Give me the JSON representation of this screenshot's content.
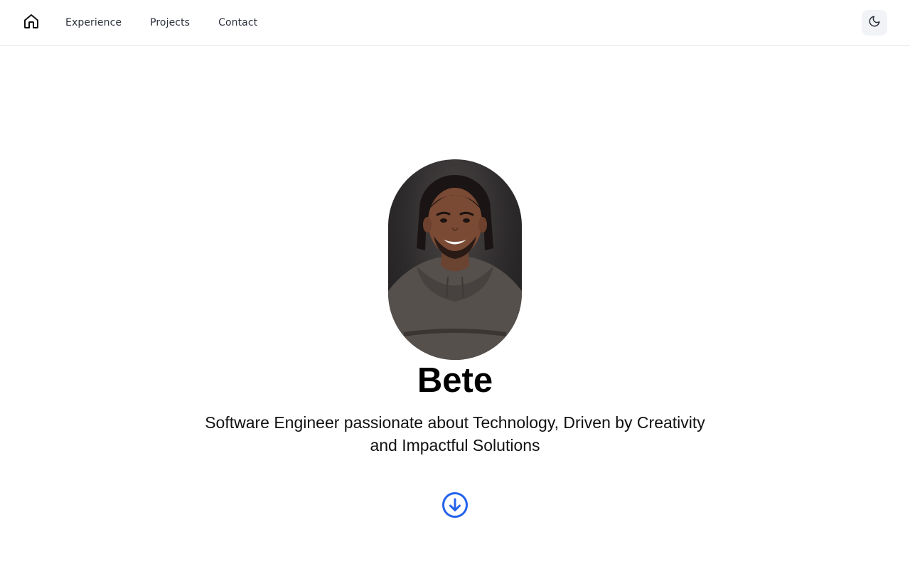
{
  "nav": {
    "home_icon": "home-icon",
    "links": [
      {
        "label": "Experience"
      },
      {
        "label": "Projects"
      },
      {
        "label": "Contact"
      }
    ],
    "theme_icon": "moon-icon"
  },
  "hero": {
    "name": "Bete",
    "tagline_line1": "Software Engineer passionate about Technology, Driven by Creativity",
    "tagline_line2": "and Impactful Solutions",
    "scroll_icon": "arrow-down-circle-icon"
  },
  "colors": {
    "accent": "#2563eb",
    "text": "#111111",
    "nav_text": "#2a2f3a",
    "toggle_bg": "#f1f3f6",
    "border": "#e6e6e6"
  }
}
